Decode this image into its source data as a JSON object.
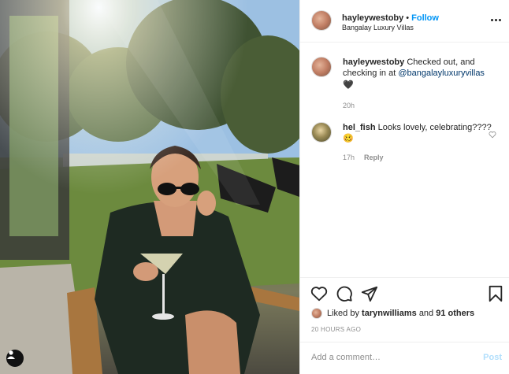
{
  "post": {
    "photo_alt": "",
    "user_tags_icon": "user-icon"
  },
  "header": {
    "username": "hayleywestoby",
    "separator": "•",
    "follow_label": "Follow",
    "location": "Bangalay Luxury Villas",
    "more_icon": "more-icon"
  },
  "caption": {
    "username": "hayleywestoby",
    "text": "Checked out, and checking in at",
    "mention": "@bangalayluxuryvillas",
    "emoji": "🖤",
    "age": "20h"
  },
  "comments": [
    {
      "username": "hel_fish",
      "text": "Looks lovely, celebrating???? 🥴",
      "age": "17h",
      "reply_label": "Reply"
    }
  ],
  "actions": {
    "like_icon": "heart-icon",
    "comment_icon": "comment-icon",
    "share_icon": "send-icon",
    "save_icon": "bookmark-icon"
  },
  "likes": {
    "prefix": "Liked by",
    "user": "tarynwilliams",
    "joiner": "and",
    "others": "91 others"
  },
  "timestamp": "20 HOURS AGO",
  "add_comment": {
    "placeholder": "Add a comment…",
    "post_label": "Post"
  }
}
